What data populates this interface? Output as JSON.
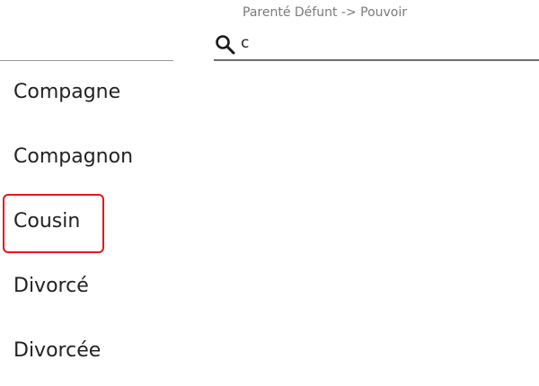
{
  "header": {
    "title": "Parenté Défunt -> Pouvoir"
  },
  "search": {
    "value": "c",
    "icon": "search-icon"
  },
  "list": {
    "items": [
      {
        "label": "Compagne"
      },
      {
        "label": "Compagnon"
      },
      {
        "label": "Cousin",
        "highlighted": true
      },
      {
        "label": "Divorcé"
      },
      {
        "label": "Divorcée"
      }
    ]
  },
  "colors": {
    "highlight": "#e8161b",
    "text": "#222222",
    "muted": "#7a7a7a"
  }
}
